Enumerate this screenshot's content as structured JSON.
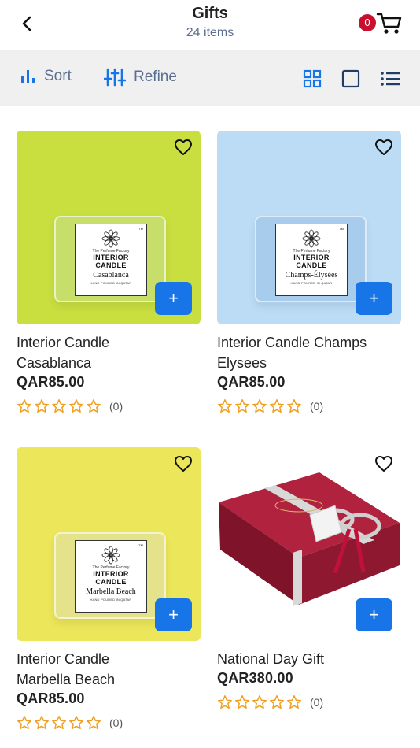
{
  "header": {
    "title": "Gifts",
    "subtitle": "24 items",
    "cart_count": "0"
  },
  "toolbar": {
    "sort_label": "Sort",
    "refine_label": "Refine"
  },
  "colors": {
    "accent": "#1875e8",
    "badge": "#c8102e",
    "star": "#f0a020"
  },
  "products": [
    {
      "name_line1": "Interior Candle",
      "name_line2": "Casablanca",
      "price": "QAR85.00",
      "rating_count": "(0)",
      "bg": "#c9df3f",
      "wax": "#c7de6b",
      "label": {
        "brand": "The Perfume Factory",
        "line1": "INTERIOR",
        "line2": "CANDLE",
        "scent": "Casablanca",
        "foot": "HAND POURED IN QATAR",
        "tm": "TM"
      }
    },
    {
      "name_line1": "Interior Candle Champs",
      "name_line2": "Elysees",
      "price": "QAR85.00",
      "rating_count": "(0)",
      "bg": "#bcdcf5",
      "wax": "#a8ccec",
      "label": {
        "brand": "The Perfume Factory",
        "line1": "INTERIOR",
        "line2": "CANDLE",
        "scent": "Champs-Élysées",
        "foot": "HAND POURED IN QATAR",
        "tm": "TM"
      }
    },
    {
      "name_line1": "Interior Candle",
      "name_line2": "Marbella Beach",
      "price": "QAR85.00",
      "rating_count": "(0)",
      "bg": "#ece65a",
      "wax": "#e4e28a",
      "label": {
        "brand": "The Perfume Factory",
        "line1": "INTERIOR",
        "line2": "CANDLE",
        "scent": "Marbella Beach",
        "foot": "HAND POURED IN QATAR",
        "tm": "TM"
      }
    },
    {
      "name_line1": "National Day Gift",
      "name_line2": "",
      "price": "QAR380.00",
      "rating_count": "(0)",
      "bg": "#ffffff",
      "box": "#9e1b34",
      "ribbon": "#d8d8d8"
    }
  ]
}
